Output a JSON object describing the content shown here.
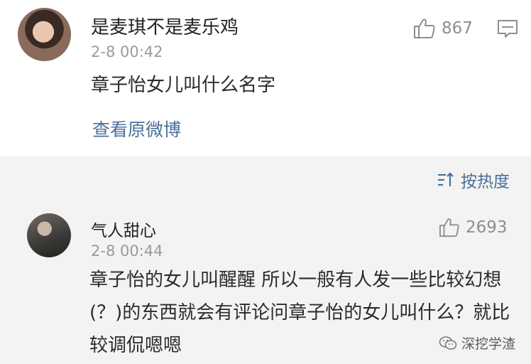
{
  "comments": [
    {
      "username": "是麦琪不是麦乐鸡",
      "time": "2-8 00:42",
      "text": "章子怡女儿叫什么名字",
      "likes": "867",
      "link": "查看原微博"
    },
    {
      "username": "气人甜心",
      "time": "2-8 00:44",
      "text": "章子怡的女儿叫醒醒 所以一般有人发一些比较幻想(？)的东西就会有评论问章子怡的女儿叫什么？就比较调侃嗯嗯",
      "likes": "2693"
    }
  ],
  "sort_label": "按热度",
  "watermark": "深挖学渣",
  "icons": {
    "like": "thumbs-up-icon",
    "comment": "comment-icon",
    "sort": "sort-icon",
    "watermark": "wechat-icon"
  },
  "colors": {
    "link": "#4a6f99",
    "meta": "#9a9a9a",
    "background": "#f3f3f3"
  }
}
